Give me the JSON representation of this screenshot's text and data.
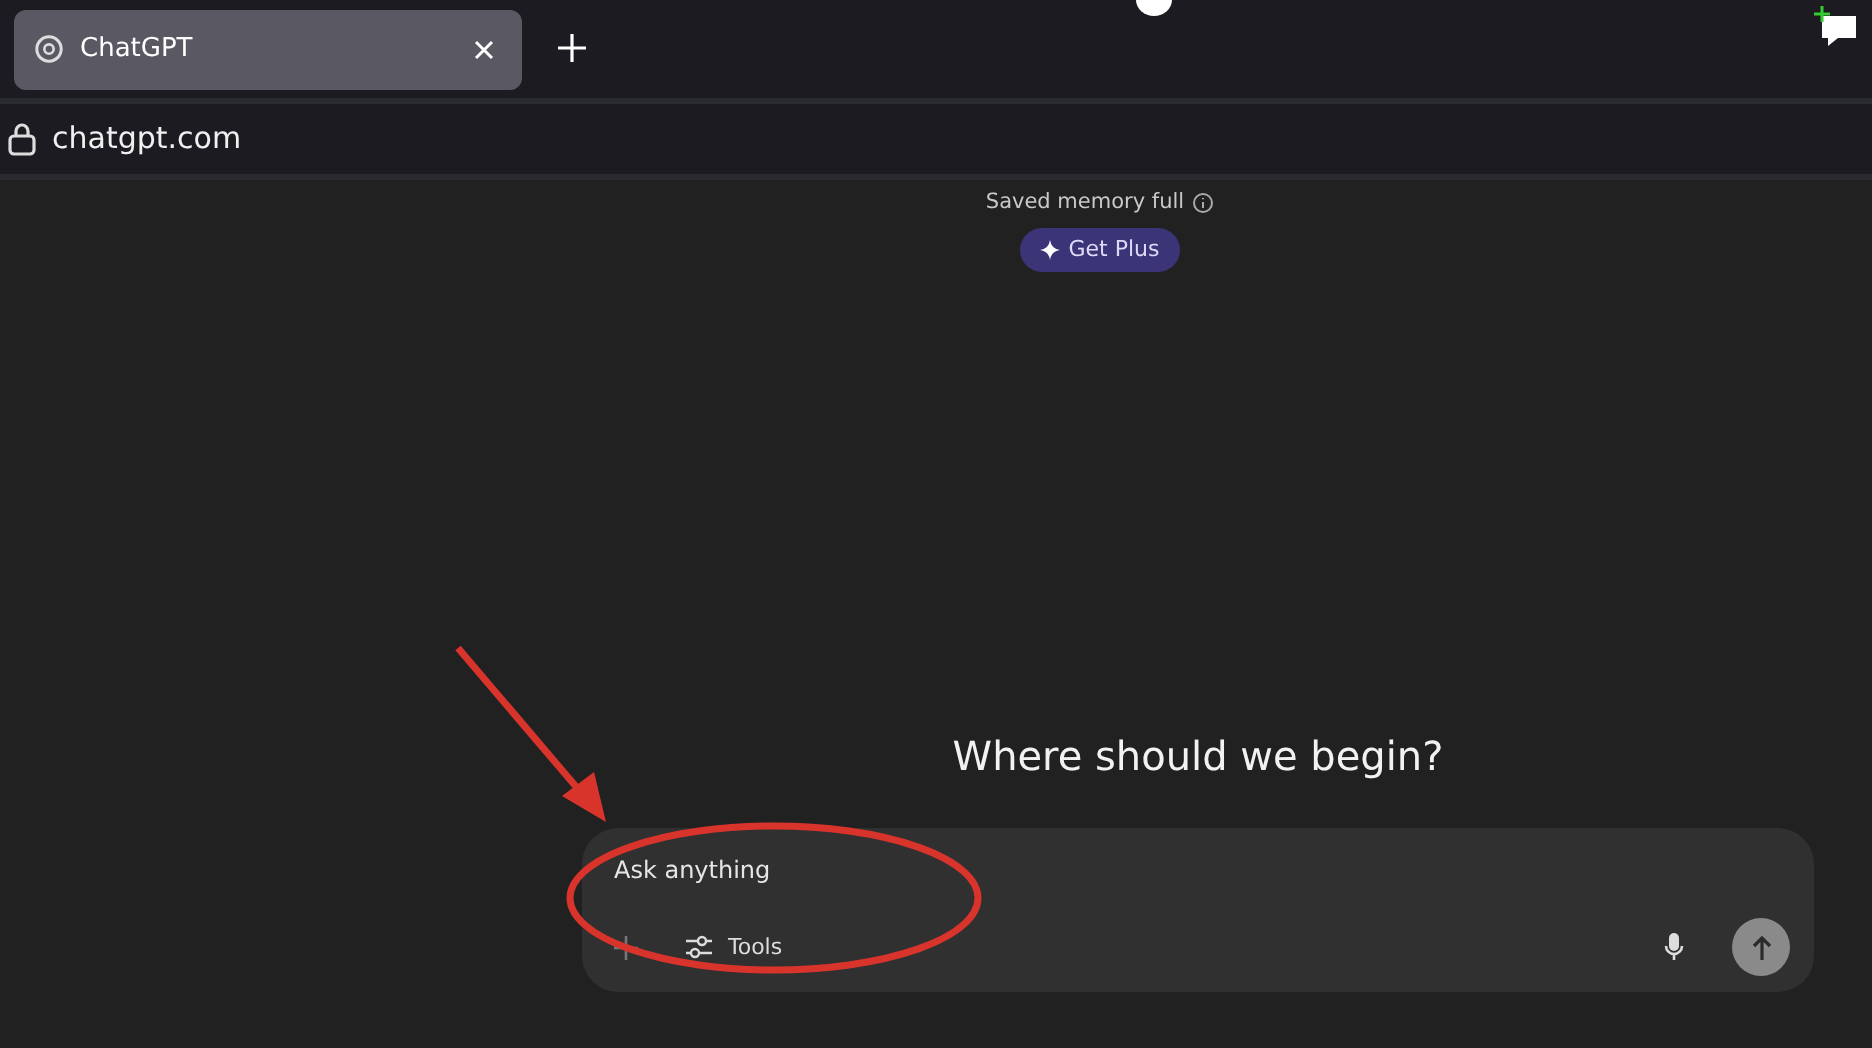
{
  "browser": {
    "tabs": [
      {
        "title": "ChatGPT",
        "selected": true
      }
    ],
    "address": "chatgpt.com"
  },
  "banner": {
    "notice": "Saved memory full",
    "button": "Get Plus"
  },
  "heading": "Where should we begin?",
  "composer": {
    "placeholder": "Ask anything",
    "tools": "Tools"
  }
}
